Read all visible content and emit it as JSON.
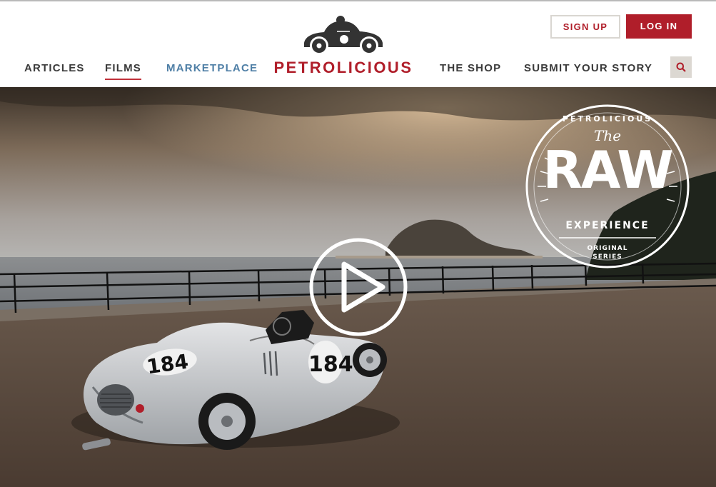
{
  "brand": {
    "name": "PETROLICIOUS"
  },
  "nav": {
    "left": [
      {
        "label": "ARTICLES"
      },
      {
        "label": "FILMS"
      },
      {
        "label": "MARKETPLACE"
      }
    ],
    "right": [
      {
        "label": "THE SHOP"
      },
      {
        "label": "SUBMIT YOUR STORY"
      }
    ]
  },
  "auth": {
    "signup_label": "SIGN UP",
    "login_label": "LOG IN"
  },
  "hero": {
    "badge": {
      "arc_text": "PETROLICIOUS",
      "the": "The",
      "title": "RAW",
      "subtitle": "EXPERIENCE",
      "series_line1": "ORIGINAL",
      "series_line2": "SERIES"
    },
    "car_number": "184"
  },
  "colors": {
    "accent": "#b01e2a",
    "nav_text": "#3b3b3b",
    "nav_highlight": "#4f7fa6"
  },
  "icons": {
    "search": "search-icon",
    "play": "play-icon",
    "logo": "car-logo-icon"
  }
}
